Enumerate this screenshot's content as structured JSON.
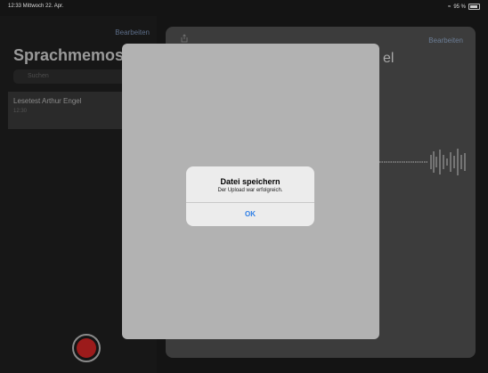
{
  "status_bar": {
    "time_date": "12:33  Mittwoch 22. Apr.",
    "battery": "95 %"
  },
  "sidebar": {
    "edit_label": "Bearbeiten",
    "title": "Sprachmemos",
    "search_placeholder": "Suchen",
    "recordings": [
      {
        "title": "Lesetest Arthur Engel",
        "time": "12:30"
      }
    ]
  },
  "detail": {
    "edit_label": "Bearbeiten",
    "title_fragment": "el",
    "ticks": [
      "",
      "",
      ""
    ],
    "times": [
      "",
      ""
    ]
  },
  "alert": {
    "title": "Datei speichern",
    "message": "Der Upload war erfolgreich.",
    "ok_label": "OK"
  }
}
